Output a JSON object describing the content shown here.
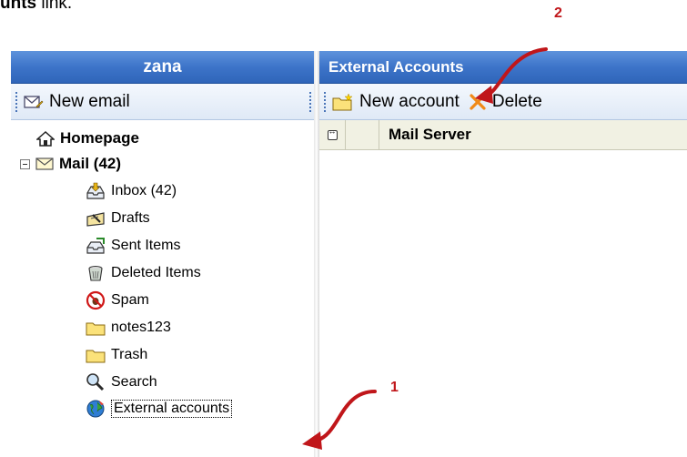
{
  "instruction": {
    "prefix": "unts",
    "suffix": " link."
  },
  "left_pane": {
    "title": "zana",
    "toolbar": {
      "new_email_label": "New email"
    },
    "tree": {
      "homepage": "Homepage",
      "mail": "Mail (42)",
      "inbox": "Inbox (42)",
      "drafts": "Drafts",
      "sent_items": "Sent Items",
      "deleted_items": "Deleted Items",
      "spam": "Spam",
      "notes": "notes123",
      "trash": "Trash",
      "search": "Search",
      "external_accounts": "External accounts"
    }
  },
  "right_pane": {
    "title": "External Accounts",
    "toolbar": {
      "new_account_label": "New account",
      "delete_label": "Delete"
    },
    "grid": {
      "column_mail_server": "Mail Server"
    }
  },
  "annotations": {
    "step1": "1",
    "step2": "2"
  },
  "colors": {
    "accent_red": "#c0161a",
    "title_blue": "#3d74c9"
  }
}
